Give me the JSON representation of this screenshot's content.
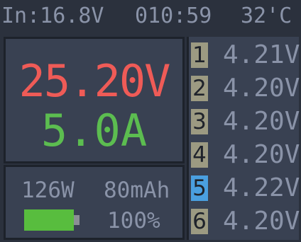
{
  "status_bar": {
    "input": "In:16.8V",
    "time": "010:59",
    "temperature": "32'C"
  },
  "main": {
    "voltage": "25.20V",
    "current": "5.0A"
  },
  "info": {
    "power": "126W",
    "capacity": "80mAh",
    "battery_percent": "100%",
    "battery_level": 1.0
  },
  "cells": [
    {
      "number": "1",
      "voltage": "4.21V"
    },
    {
      "number": "2",
      "voltage": "4.20V"
    },
    {
      "number": "3",
      "voltage": "4.20V"
    },
    {
      "number": "4",
      "voltage": "4.20V"
    },
    {
      "number": "5",
      "voltage": "4.22V"
    },
    {
      "number": "6",
      "voltage": "4.20V"
    }
  ],
  "colors": {
    "background": "#2b313d",
    "panel": "#394152",
    "border": "#1d222b",
    "status_text": "#8a93a8",
    "voltage": "#ef5b57",
    "current": "#5cbd50",
    "info_text": "#8a93a8",
    "battery": "#58bd3e",
    "cell_text": "#8a93a8",
    "cell_badge": "#9c9a82",
    "cell_badge_highlight": "#4a9fe0"
  },
  "highlighted_cell": "5"
}
